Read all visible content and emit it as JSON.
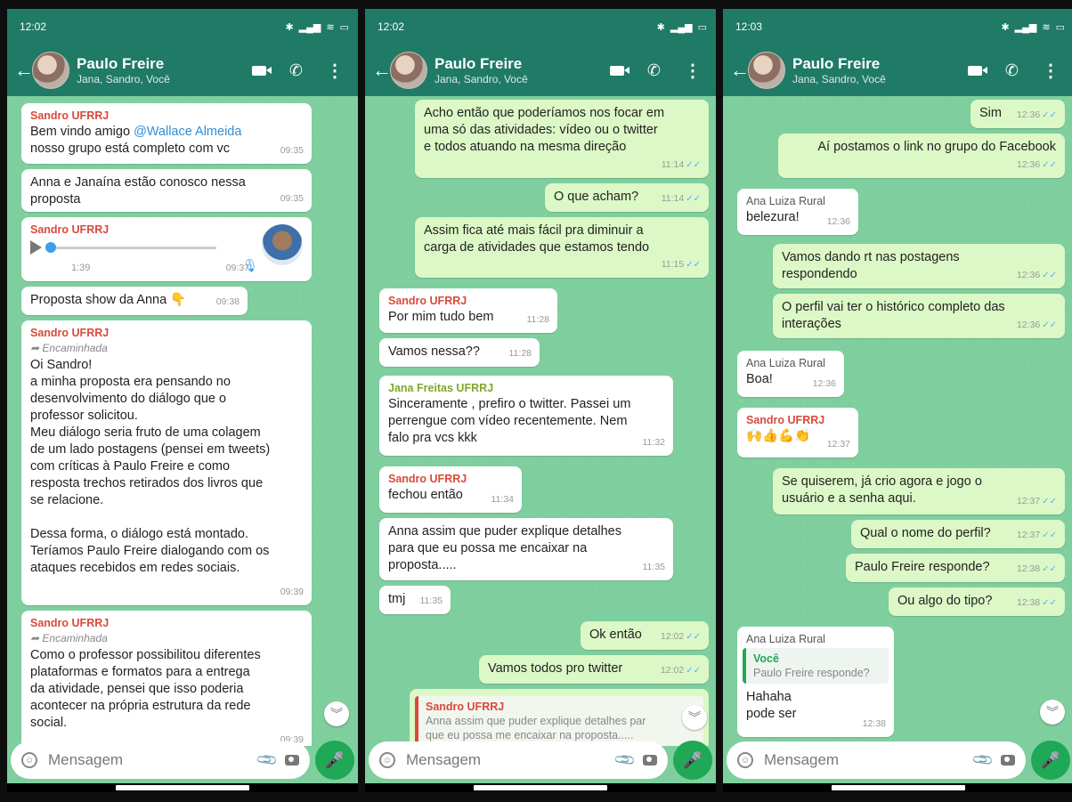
{
  "header": {
    "contact_name": "Paulo Freire",
    "participants": "Jana, Sandro, Você"
  },
  "composer": {
    "placeholder": "Mensagem"
  },
  "screens": [
    {
      "clock": "12:02",
      "messages": [
        {
          "sender": "Sandro UFRRJ",
          "pre": "Bem vindo amigo ",
          "mention": "@Wallace Almeida",
          "post": "\nnosso grupo está completo com vc",
          "time": "09:35"
        },
        {
          "text": "Anna e Janaína estão conosco nessa\nproposta",
          "time": "09:35"
        },
        {
          "sender": "Sandro UFRRJ",
          "audio_duration": "1:39",
          "time": "09:37"
        },
        {
          "text": "Proposta show da Anna 👇",
          "time": "09:38"
        },
        {
          "sender": "Sandro UFRRJ",
          "forwarded": "Encaminhada",
          "text": "Oi Sandro!\na minha proposta era pensando no\ndesenvolvimento do diálogo que o\nprofessor solicitou.\nMeu diálogo seria fruto de uma colagem\nde um lado postagens (pensei em tweets)\ncom críticas à Paulo Freire e como\nresposta trechos retirados dos livros que\nse relacione.\n\nDessa forma, o diálogo está montado.\nTeríamos Paulo Freire dialogando com os\nataques recebidos em redes sociais.",
          "time": "09:39"
        },
        {
          "sender": "Sandro UFRRJ",
          "forwarded": "Encaminhada",
          "text": "Como o professor possibilitou diferentes\nplataformas e formatos para a entrega\nda atividade, pensei que isso poderia\nacontecer na própria estrutura da rede\nsocial.",
          "time": "09:39"
        }
      ]
    },
    {
      "clock": "12:02",
      "messages": [
        {
          "text": "Acho então que poderíamos nos focar em\numa só das atividades: vídeo ou o twitter\ne todos atuando na mesma direção",
          "time": "11:14"
        },
        {
          "text": "O que acham?",
          "time": "11:14"
        },
        {
          "text": "Assim fica até mais fácil pra diminuir a\ncarga de atividades que estamos tendo",
          "time": "11:15"
        },
        {
          "sender": "Sandro UFRRJ",
          "text": "Por mim tudo bem",
          "time": "11:28"
        },
        {
          "text": "Vamos nessa??",
          "time": "11:28"
        },
        {
          "sender": "Jana Freitas UFRRJ",
          "text": "Sinceramente , prefiro o twitter. Passei um\nperrengue com vídeo recentemente. Nem\nfalo pra vcs kkk",
          "time": "11:32"
        },
        {
          "sender": "Sandro UFRRJ",
          "text": "fechou então",
          "time": "11:34"
        },
        {
          "text": "Anna assim que puder explique detalhes\npara que eu possa me encaixar na\nproposta.....",
          "time": "11:35"
        },
        {
          "text": "tmj",
          "time": "11:35"
        },
        {
          "text": "Ok então",
          "time": "12:02"
        },
        {
          "text": "Vamos todos pro twitter",
          "time": "12:02"
        },
        {
          "quote_sender": "Sandro UFRRJ",
          "quote_text": "Anna assim que puder explique detalhes par\nque eu possa me encaixar na proposta....."
        }
      ]
    },
    {
      "clock": "12:03",
      "messages": [
        {
          "text": "Sim",
          "time": "12:36"
        },
        {
          "text": "Aí postamos o link no grupo do Facebook",
          "time": "12:36"
        },
        {
          "sender": "Ana Luiza Rural",
          "text": "belezura!",
          "time": "12:36"
        },
        {
          "text": "Vamos dando rt nas postagens\nrespondendo",
          "time": "12:36"
        },
        {
          "text": "O perfil vai ter o histórico completo das\ninterações",
          "time": "12:36"
        },
        {
          "sender": "Ana Luiza Rural",
          "text": "Boa!",
          "time": "12:36"
        },
        {
          "sender": "Sandro UFRRJ",
          "text": "🙌👍💪👏",
          "time": "12:37"
        },
        {
          "text": "Se quiserem, já crio agora e jogo o\nusuário e a senha aqui.",
          "time": "12:37"
        },
        {
          "text": "Qual o nome do perfil?",
          "time": "12:37"
        },
        {
          "text": "Paulo Freire responde?",
          "time": "12:38"
        },
        {
          "text": "Ou algo do tipo?",
          "time": "12:38"
        },
        {
          "sender": "Ana Luiza Rural",
          "quote_sender": "Você",
          "quote_text": "Paulo Freire responde?",
          "text": "Hahaha\npode ser",
          "time": "12:38"
        }
      ]
    }
  ]
}
